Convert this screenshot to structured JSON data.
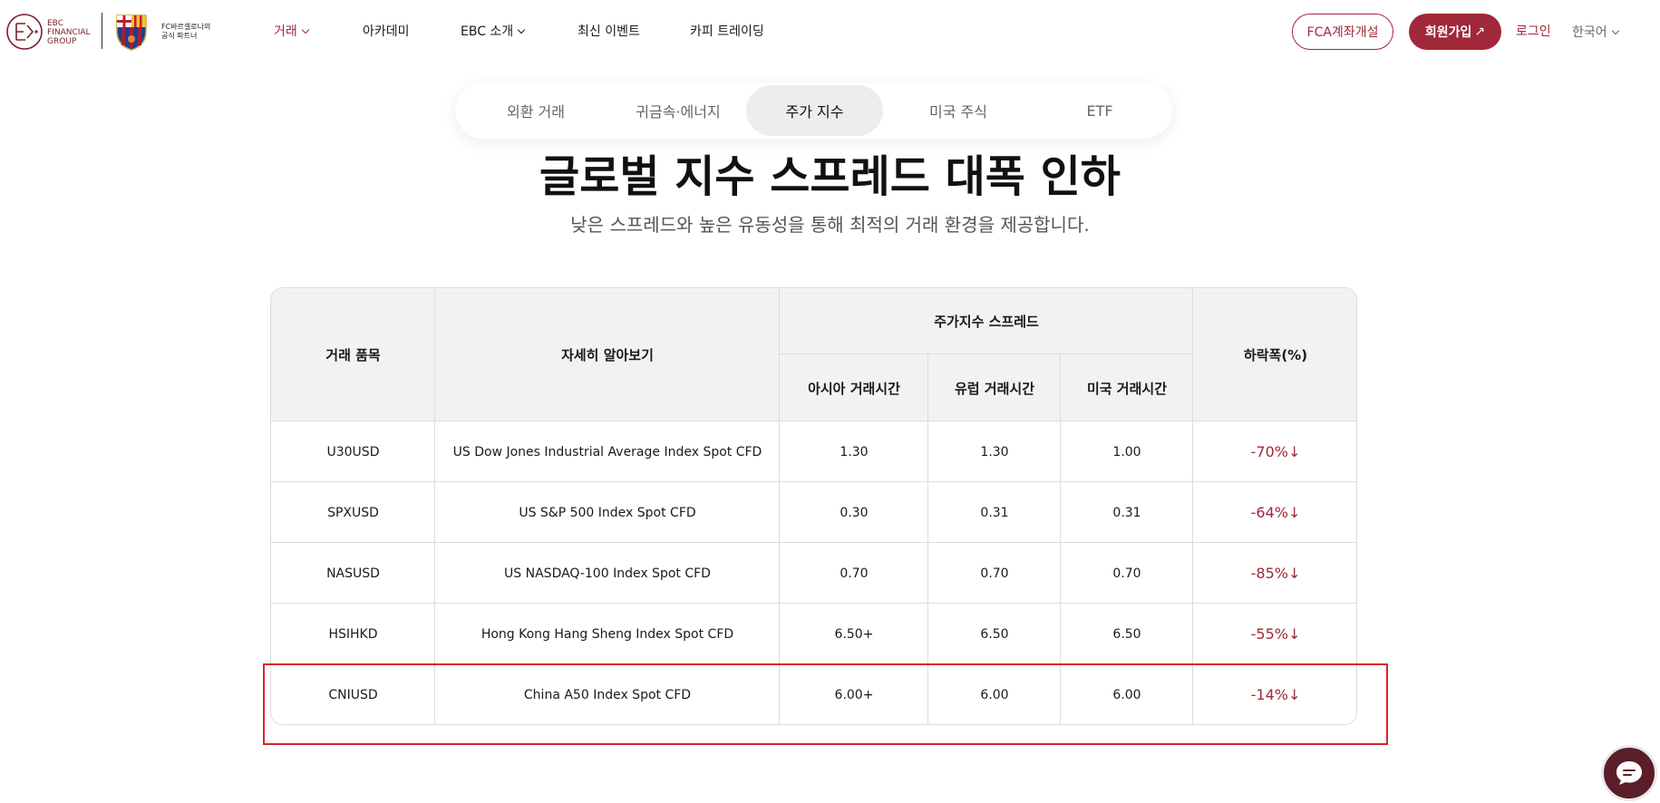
{
  "header": {
    "logo_lines": [
      "EBC",
      "FINANCIAL",
      "GROUP"
    ],
    "partner_lines": [
      "FC바르셀로나의",
      "공식 파트너"
    ],
    "nav": [
      {
        "label": "거래",
        "active": true,
        "dropdown": true
      },
      {
        "label": "아카데미",
        "active": false,
        "dropdown": false
      },
      {
        "label": "EBC 소개",
        "active": false,
        "dropdown": true
      },
      {
        "label": "최신 이벤트",
        "active": false,
        "dropdown": false
      },
      {
        "label": "카피 트레이딩",
        "active": false,
        "dropdown": false
      }
    ],
    "open_account": "FCA계좌개설",
    "signup": "회원가입",
    "signup_arrow": "↗",
    "login": "로그인",
    "language": "한국어"
  },
  "tabs": [
    {
      "label": "외환 거래",
      "active": false
    },
    {
      "label": "귀금속·에너지",
      "active": false
    },
    {
      "label": "주가 지수",
      "active": true
    },
    {
      "label": "미국 주식",
      "active": false
    },
    {
      "label": "ETF",
      "active": false
    }
  ],
  "title": "글로벌 지수 스프레드 대폭 인하",
  "subtitle": "낮은 스프레드와 높은 유동성을 통해 최적의 거래 환경을 제공합니다.",
  "table": {
    "headers": {
      "product": "거래 품목",
      "details": "자세히 알아보기",
      "spread_group": "주가지수 스프레드",
      "asia": "아시아 거래시간",
      "europe": "유럽 거래시간",
      "us": "미국 거래시간",
      "drop": "하락폭(%)"
    },
    "rows": [
      {
        "product": "U30USD",
        "details": "US Dow Jones Industrial Average Index Spot CFD",
        "asia": "1.30",
        "europe": "1.30",
        "us": "1.00",
        "drop": "-70%↓"
      },
      {
        "product": "SPXUSD",
        "details": "US S&P 500 Index Spot CFD",
        "asia": "0.30",
        "europe": "0.31",
        "us": "0.31",
        "drop": "-64%↓"
      },
      {
        "product": "NASUSD",
        "details": "US NASDAQ-100 Index Spot CFD",
        "asia": "0.70",
        "europe": "0.70",
        "us": "0.70",
        "drop": "-85%↓"
      },
      {
        "product": "HSIHKD",
        "details": "Hong Kong Hang Sheng Index Spot CFD",
        "asia": "6.50+",
        "europe": "6.50",
        "us": "6.50",
        "drop": "-55%↓"
      },
      {
        "product": "CNIUSD",
        "details": "China A50 Index Spot CFD",
        "asia": "6.00+",
        "europe": "6.00",
        "us": "6.00",
        "drop": "-14%↓"
      }
    ]
  },
  "colors": {
    "brand": "#a0283a",
    "highlight": "#e0222a",
    "chat": "#5a1e28"
  },
  "icons": [
    "ebc-logo-icon",
    "fc-barcelona-crest-icon",
    "chevron-down-icon",
    "chat-icon"
  ]
}
